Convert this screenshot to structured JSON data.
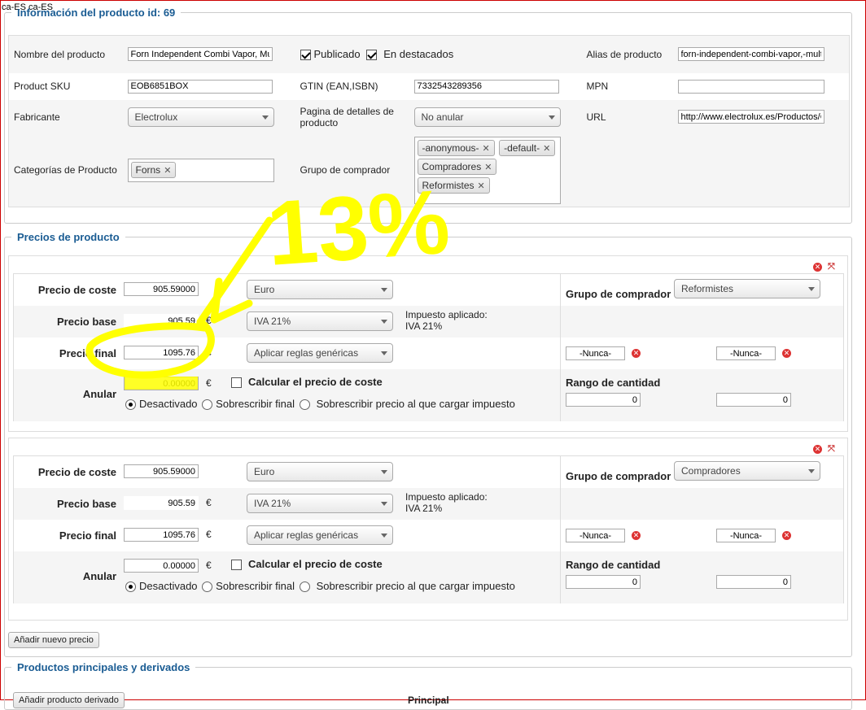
{
  "locale_label": "ca-ES ca-ES",
  "info": {
    "legend": "Información del producto id: 69",
    "name_label": "Nombre del producto",
    "name_value": "Forn Independent Combi Vapor, Multi",
    "published_label": "Publicado",
    "featured_label": "En destacados",
    "alias_label": "Alias de producto",
    "alias_value": "forn-independent-combi-vapor,-multi-",
    "sku_label": "Product SKU",
    "sku_value": "EOB6851BOX",
    "gtin_label": "GTIN (EAN,ISBN)",
    "gtin_value": "7332543289356",
    "mpn_label": "MPN",
    "mpn_value": "",
    "manufacturer_label": "Fabricante",
    "manufacturer_value": "Electrolux",
    "details_page_label": "Pagina de detalles de producto",
    "details_page_value": "No anular",
    "url_label": "URL",
    "url_value": "http://www.electrolux.es/Productos/C",
    "categories_label": "Categorías de Producto",
    "categories": [
      "Forns"
    ],
    "buyer_group_label": "Grupo de comprador",
    "buyer_groups": [
      "-anonymous-",
      "-default-",
      "Compradores",
      "Reformistes"
    ]
  },
  "prices_legend": "Precios de producto",
  "price_labels": {
    "cost": "Precio de coste",
    "base": "Precio base",
    "final": "Precio final",
    "override": "Anular",
    "currency_symbol": "€",
    "tax_applied": "Impuesto aplicado:",
    "calc_cost": "Calcular el precio de coste",
    "radio_disabled": "Desactivado",
    "radio_overwrite_final": "Sobrescribir final",
    "radio_overwrite_taxable": "Sobrescribir precio al que cargar impuesto",
    "buyer_group": "Grupo de comprador",
    "qty_range": "Rango de cantidad"
  },
  "price_blocks": [
    {
      "cost": "905.59000",
      "currency": "Euro",
      "base": "905.59",
      "tax_rule": "IVA 21%",
      "tax_applied_value": "IVA 21%",
      "final": "1095.76",
      "rules": "Aplicar reglas genéricas",
      "override": "0.00000",
      "buyer_group": "Reformistes",
      "date_from": "-Nunca-",
      "date_to": "-Nunca-",
      "qty_from": "0",
      "qty_to": "0"
    },
    {
      "cost": "905.59000",
      "currency": "Euro",
      "base": "905.59",
      "tax_rule": "IVA 21%",
      "tax_applied_value": "IVA 21%",
      "final": "1095.76",
      "rules": "Aplicar reglas genéricas",
      "override": "0.00000",
      "buyer_group": "Compradores",
      "date_from": "-Nunca-",
      "date_to": "-Nunca-",
      "qty_from": "0",
      "qty_to": "0"
    }
  ],
  "add_price_button": "Añadir nuevo precio",
  "derived": {
    "legend": "Productos principales y derivados",
    "add_derived_button": "Añadir producto derivado",
    "principal_label": "Principal"
  },
  "annotation_text": "13%",
  "colors": {
    "legend_blue": "#1a5c93",
    "annotation_yellow": "#ffff00",
    "delete_red": "#dd3333"
  }
}
